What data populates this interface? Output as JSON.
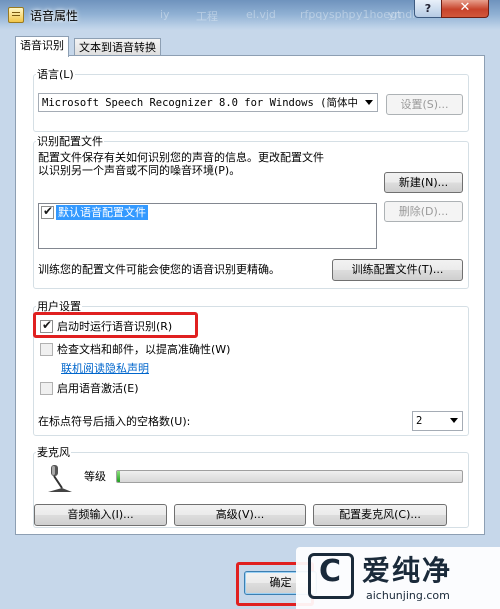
{
  "window": {
    "title": "语音属性",
    "help_glyph": "?",
    "close_glyph": "✕",
    "background_text": [
      "iy",
      "工程",
      "el.vjd",
      "rfpqysphp",
      "y1hoegt",
      "ymdhb"
    ]
  },
  "tabs": [
    {
      "label": "语音识别",
      "active": true
    },
    {
      "label": "文本到语音转换",
      "active": false
    }
  ],
  "language_group": {
    "title": "语言(L)",
    "selected": "Microsoft Speech Recognizer 8.0 for Windows (简体中",
    "settings_button": "设置(S)..."
  },
  "profile_group": {
    "title": "识别配置文件",
    "description_line1": "配置文件保存有关如何识别您的声音的信息。更改配置文件",
    "description_line2": "以识别另一个声音或不同的噪音环境(P)。",
    "new_button": "新建(N)...",
    "delete_button": "删除(D)...",
    "profiles": [
      {
        "label": "默认语音配置文件",
        "checked": true,
        "selected": true
      }
    ],
    "train_text": "训练您的配置文件可能会使您的语音识别更精确。",
    "train_button": "训练配置文件(T)..."
  },
  "user_settings": {
    "title": "用户设置",
    "run_at_startup": {
      "label": "启动时运行语音识别(R)",
      "checked": true
    },
    "review_docs": {
      "label": "检查文档和邮件，以提高准确性(W)",
      "checked": false
    },
    "privacy_link": "联机阅读隐私声明",
    "voice_activation": {
      "label": "启用语音激活(E)",
      "checked": false
    },
    "spaces_label": "在标点符号后插入的空格数(U):",
    "spaces_value": "2"
  },
  "microphone": {
    "title": "麦克风",
    "level_label": "等级",
    "level": 0.01,
    "audio_input_button": "音频输入(I)...",
    "advanced_button": "高级(V)...",
    "configure_button": "配置麦克风(C)..."
  },
  "footer": {
    "ok_button": "确定"
  },
  "watermark": {
    "logo_glyph": "C",
    "title": "爱纯净",
    "url": "aichunjing.com"
  },
  "colors": {
    "highlight": "#e02020",
    "link": "#0066cc",
    "selection": "#3399ff"
  }
}
